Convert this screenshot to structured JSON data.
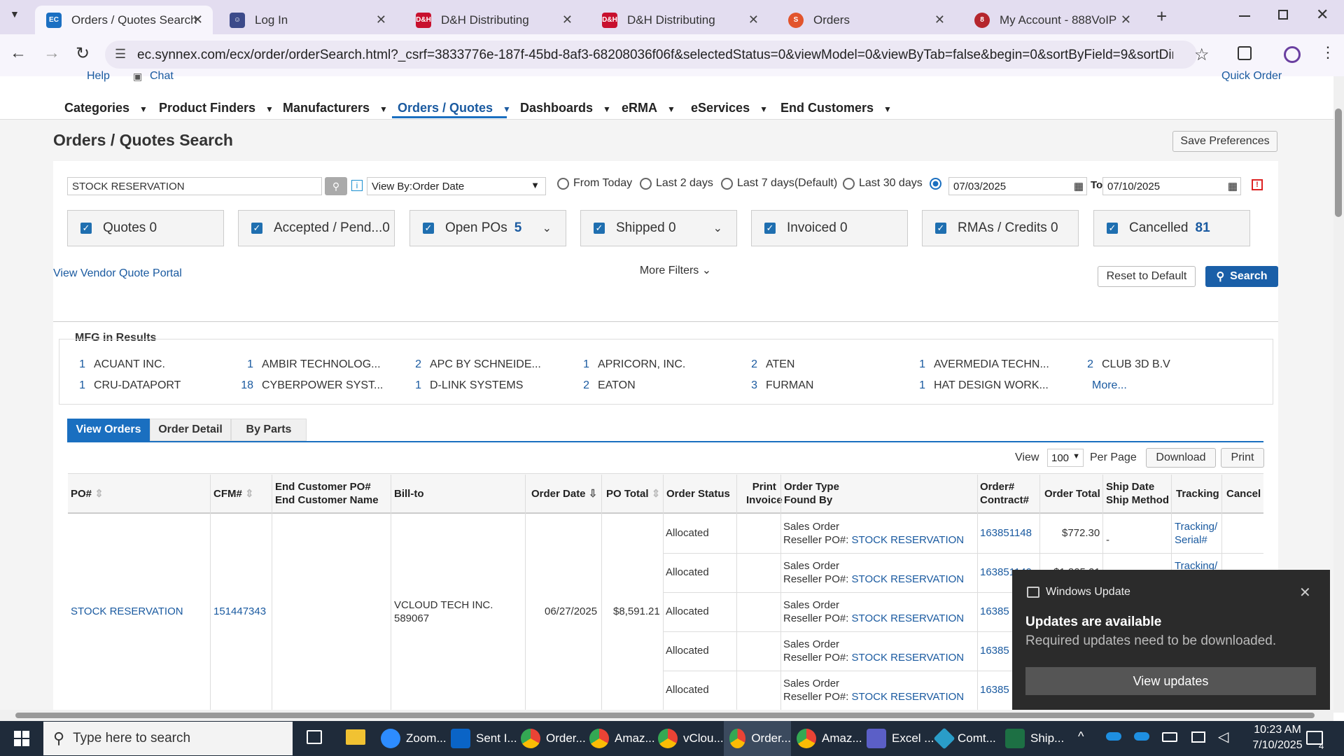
{
  "browser": {
    "tabs": [
      {
        "label": "Orders / Quotes Search- E",
        "icon": "ec-logo-icon",
        "active": true
      },
      {
        "label": "Log In",
        "icon": "lock-person-icon"
      },
      {
        "label": "D&H Distributing",
        "icon": "dh-logo-icon"
      },
      {
        "label": "D&H Distributing",
        "icon": "dh-logo-icon"
      },
      {
        "label": "Orders",
        "icon": "orders-logo-icon"
      },
      {
        "label": "My Account - 888VoIP",
        "icon": "voip-logo-icon"
      }
    ],
    "url": "ec.synnex.com/ecx/order/orderSearch.html?_csrf=3833776e-187f-45bd-8af3-68208036f06f&selectedStatus=0&viewModel=0&viewByTab=false&begin=0&sortByField=9&sortDirection=1&off..."
  },
  "top_links": {
    "help": "Help",
    "chat": "Chat",
    "quick_order": "Quick Order"
  },
  "nav": [
    "Categories",
    "Product Finders",
    "Manufacturers",
    "Orders / Quotes",
    "Dashboards",
    "eRMA",
    "eServices",
    "End Customers"
  ],
  "page_title": "Orders / Quotes Search",
  "save_preferences": "Save Preferences",
  "search": {
    "value": "STOCK RESERVATION",
    "view_by": "View By:Order Date",
    "ranges": [
      "From Today",
      "Last 2 days",
      "Last 7 days(Default)",
      "Last 30 days"
    ],
    "from_date": "07/03/2025",
    "to_label": "To",
    "to_date": "07/10/2025"
  },
  "status_filters": [
    {
      "label": "Quotes 0",
      "count": ""
    },
    {
      "label": "Accepted / Pend...0",
      "count": ""
    },
    {
      "label": "Open POs",
      "count": "5"
    },
    {
      "label": "Shipped 0",
      "count": ""
    },
    {
      "label": "Invoiced 0",
      "count": ""
    },
    {
      "label": "RMAs / Credits 0",
      "count": ""
    },
    {
      "label": "Cancelled",
      "count": "81"
    }
  ],
  "vendor_portal": "View Vendor Quote Portal",
  "more_filters": "More Filters",
  "reset": "Reset to Default",
  "search_btn": "Search",
  "mfg": {
    "title": "MFG in Results",
    "items": [
      {
        "n": "1",
        "name": "ACUANT INC."
      },
      {
        "n": "1",
        "name": "AMBIR TECHNOLOG..."
      },
      {
        "n": "2",
        "name": "APC BY SCHNEIDE..."
      },
      {
        "n": "1",
        "name": "APRICORN, INC."
      },
      {
        "n": "2",
        "name": "ATEN"
      },
      {
        "n": "1",
        "name": "AVERMEDIA TECHN..."
      },
      {
        "n": "2",
        "name": "CLUB 3D B.V"
      },
      {
        "n": "1",
        "name": "CRU-DATAPORT"
      },
      {
        "n": "18",
        "name": "CYBERPOWER SYST..."
      },
      {
        "n": "1",
        "name": "D-LINK SYSTEMS"
      },
      {
        "n": "2",
        "name": "EATON"
      },
      {
        "n": "3",
        "name": "FURMAN"
      },
      {
        "n": "1",
        "name": "HAT DESIGN WORK..."
      }
    ],
    "more": "More..."
  },
  "result_tabs": [
    "View Orders",
    "Order Detail",
    "By Parts"
  ],
  "pager": {
    "view": "View",
    "per_page_value": "100",
    "per_page": "Per Page",
    "download": "Download",
    "print": "Print"
  },
  "table": {
    "headers": {
      "po": "PO#",
      "cfm": "CFM#",
      "end_po": "End Customer PO#",
      "end_name": "End Customer Name",
      "bill_to": "Bill-to",
      "order_date": "Order Date",
      "po_total": "PO Total",
      "order_status": "Order Status",
      "print1": "Print",
      "print2": "Invoice",
      "type1": "Order Type",
      "type2": "Found By",
      "ord1": "Order#",
      "ord2": "Contract#",
      "order_total": "Order Total",
      "ship1": "Ship Date",
      "ship2": "Ship Method",
      "tracking": "Tracking",
      "cancel": "Cancel"
    },
    "group": {
      "po": "STOCK RESERVATION",
      "cfm": "151447343",
      "bill_to_1": "VCLOUD TECH INC.",
      "bill_to_2": "589067",
      "order_date": "06/27/2025",
      "po_total": "$8,591.21"
    },
    "rows": [
      {
        "status": "Allocated",
        "type": "Sales Order",
        "found_label": "Reseller PO#:",
        "found": "STOCK RESERVATION",
        "order": "163851148",
        "total": "$772.30",
        "ship": "-",
        "tracking1": "Tracking/",
        "tracking2": "Serial#"
      },
      {
        "status": "Allocated",
        "type": "Sales Order",
        "found_label": "Reseller PO#:",
        "found": "STOCK RESERVATION",
        "order": "163851149",
        "total": "$1,825.21",
        "ship": "",
        "tracking1": "Tracking/",
        "tracking2": ""
      },
      {
        "status": "Allocated",
        "type": "Sales Order",
        "found_label": "Reseller PO#:",
        "found": "STOCK RESERVATION",
        "order": "16385",
        "total": "",
        "ship": "",
        "tracking1": "",
        "tracking2": ""
      },
      {
        "status": "Allocated",
        "type": "Sales Order",
        "found_label": "Reseller PO#:",
        "found": "STOCK RESERVATION",
        "order": "16385",
        "total": "",
        "ship": "",
        "tracking1": "",
        "tracking2": ""
      },
      {
        "status": "Allocated",
        "type": "Sales Order",
        "found_label": "Reseller PO#:",
        "found": "STOCK RESERVATION",
        "order": "16385",
        "total": "",
        "ship": "",
        "tracking1": "",
        "tracking2": ""
      }
    ]
  },
  "toast": {
    "app": "Windows Update",
    "title": "Updates are available",
    "body": "Required updates need to be downloaded.",
    "action": "View updates"
  },
  "taskbar": {
    "search_placeholder": "Type here to search",
    "apps": [
      "Zoom...",
      "Sent I...",
      "Order...",
      "Amaz...",
      "vClou...",
      "Order...",
      "Amaz...",
      "Excel ...",
      "Comt...",
      "Ship..."
    ],
    "time": "10:23 AM",
    "date": "7/10/2025",
    "notif_count": "4"
  }
}
